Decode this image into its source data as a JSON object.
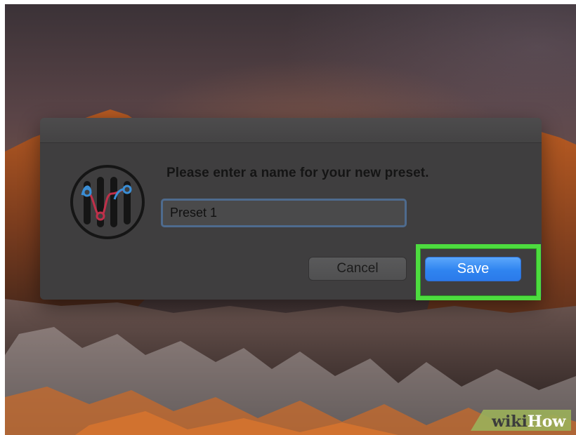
{
  "dialog": {
    "message": "Please enter a name for your new preset.",
    "name_field": {
      "value": "Preset 1",
      "focused": true
    },
    "buttons": {
      "cancel_label": "Cancel",
      "save_label": "Save"
    },
    "app_icon": "equalizer-preset-icon"
  },
  "annotation": {
    "highlight_target": "save-button",
    "highlight_color": "#4ddc3f"
  },
  "watermark": {
    "text_a": "wiki",
    "text_b": "How",
    "logo": "wikihow-logo"
  },
  "colors": {
    "accent_blue": "#2f84f0",
    "icon_blue": "#3a8ed6",
    "icon_red": "#c0304a"
  }
}
